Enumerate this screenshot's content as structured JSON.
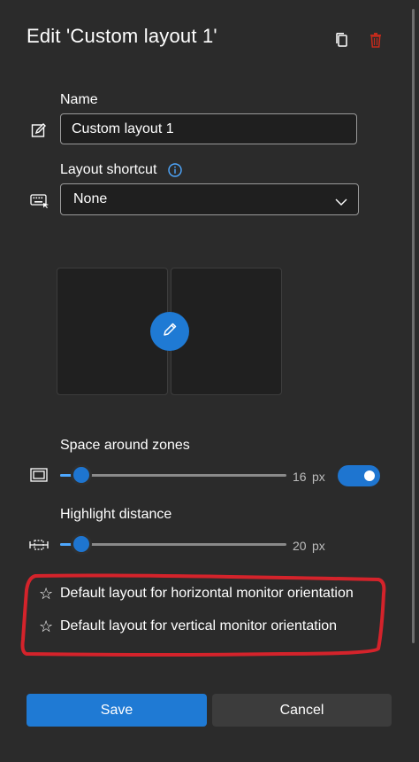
{
  "dialog": {
    "title": "Edit 'Custom layout 1'",
    "icons": {
      "copy": "copy-icon",
      "delete": "delete-icon"
    },
    "colors": {
      "accent": "#1f7ad4",
      "delete": "#c42b1c",
      "background": "#2b2b2b",
      "annotation": "#d4232b"
    }
  },
  "name_field": {
    "label": "Name",
    "value": "Custom layout 1",
    "icon": "edit-icon"
  },
  "shortcut_field": {
    "label": "Layout shortcut",
    "info_icon": "info-icon",
    "selected": "None",
    "icon": "keyboard-icon"
  },
  "layout_preview": {
    "zones": 2,
    "edit_icon": "pencil-icon"
  },
  "space_around_zones": {
    "label": "Space around zones",
    "value": "16",
    "unit": "px",
    "slider_fraction": 0.07,
    "toggle_on": true,
    "icon": "space-around-icon"
  },
  "highlight_distance": {
    "label": "Highlight distance",
    "value": "20",
    "unit": "px",
    "slider_fraction": 0.07,
    "icon": "highlight-distance-icon"
  },
  "defaults": {
    "horizontal": "Default layout for horizontal monitor orientation",
    "vertical": "Default layout for vertical monitor orientation",
    "star_glyph": "☆"
  },
  "footer": {
    "save_label": "Save",
    "cancel_label": "Cancel"
  }
}
